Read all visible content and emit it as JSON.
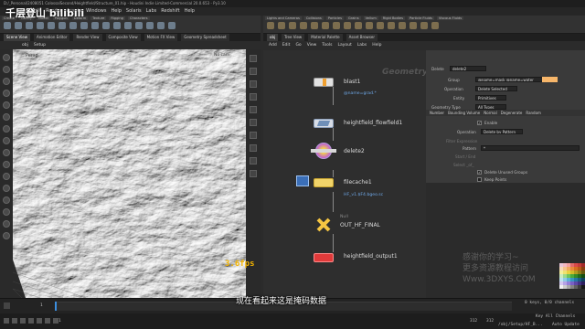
{
  "window": {
    "title": "D:/_Personal/2408051 ColossalSecond/Heightfield/Structure_01.hip - Houdini Indie Limited-Commercial 20.0.653 - Py3.10"
  },
  "menu": [
    "File",
    "Edit",
    "Render",
    "Assets",
    "Windows",
    "Help",
    "Solaris",
    "Labs",
    "Redshift",
    "Help"
  ],
  "watermark": "千层登山 bilibili",
  "shelf_left_tabs": [
    "Create",
    "Modify",
    "Model",
    "Polygon",
    "Deform",
    "Texture",
    "Rigging",
    "Characters"
  ],
  "shelf_right_tabs": [
    "Lights and Cameras",
    "Collisions",
    "Particles",
    "Grains",
    "Vellum",
    "Rigid Bodies",
    "Particle Fluids",
    "Viscous Fluids"
  ],
  "pane_tabs_left": [
    "Scene View",
    "Animation Editor",
    "Render View",
    "Composite View",
    "Motion FX View",
    "Geometry Spreadsheet"
  ],
  "pane_tabs_right": [
    "obj",
    "Tree View",
    "Material Palette",
    "Asset Browser"
  ],
  "viewport": {
    "path": "obj",
    "node": "Setup",
    "camera": "Persp",
    "view": "No cam",
    "fps": "3.6fps"
  },
  "network": {
    "toolbar": [
      "Add",
      "Edit",
      "Go",
      "View",
      "Tools",
      "Layout",
      "Labs",
      "Help"
    ],
    "context_label": "Geometry",
    "nodes": [
      {
        "name": "blast1",
        "sub": "@name=grad.*"
      },
      {
        "name": "heightfield_flowfield1",
        "sub": ""
      },
      {
        "name": "delete2",
        "sub": ""
      },
      {
        "name": "filecache1",
        "sub": "HF_v1.$F4.bgeo.sc"
      },
      {
        "name": "OUT_HF_FINAL",
        "sub": "Null"
      },
      {
        "name": "heightfield_output1",
        "sub": ""
      }
    ]
  },
  "parameters": {
    "node_type": "Delete",
    "node_name": "delete2",
    "group_label": "Group",
    "group_value": "@name=mask @name=water",
    "operation_label": "Operation",
    "operation_value": "Delete Selected",
    "entity_label": "Entity",
    "entity_value": "Primitives",
    "geometry_type_label": "Geometry Type",
    "geometry_type_value": "All Types",
    "tabs": [
      "Number",
      "Bounding Volume",
      "Normal",
      "Degenerate",
      "Random"
    ],
    "enable_label": "Enable",
    "enable_checked": true,
    "op_label": "Operation",
    "op_value": "Delete by Pattern",
    "filter_label": "Filter Expression",
    "pattern_label": "Pattern",
    "pattern_value": "*",
    "startend_label": "Start / End",
    "select_label": "Select _of_",
    "delete_unused_label": "Delete Unused Groups",
    "keep_points_label": "Keep Points"
  },
  "promo": [
    "感谢你的学习~",
    "更多资源教程访问",
    "Www.3DXYS.COM"
  ],
  "subtitle": "现在看起来这是掩码数据",
  "timeline": {
    "current_frame": "1",
    "start": "1",
    "end": "312",
    "end2": "312",
    "keys_label": "0 keys, 0/0 channels",
    "key_all_label": "Key All Channels",
    "status_path": "/obj/Setup/HF_B...",
    "auto_update": "Auto Update"
  }
}
